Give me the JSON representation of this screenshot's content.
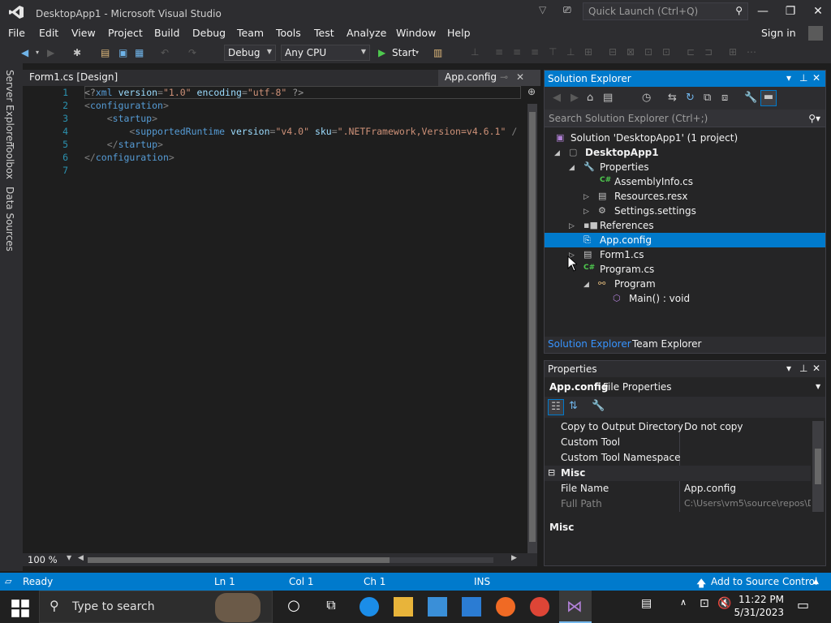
{
  "window": {
    "title": "DesktopApp1 - Microsoft Visual Studio",
    "quick_launch_placeholder": "Quick Launch (Ctrl+Q)"
  },
  "menu": [
    "File",
    "Edit",
    "View",
    "Project",
    "Build",
    "Debug",
    "Team",
    "Tools",
    "Test",
    "Analyze",
    "Window",
    "Help"
  ],
  "signin": "Sign in",
  "toolbar": {
    "config": "Debug",
    "platform": "Any CPU",
    "start": "Start"
  },
  "side_tabs": [
    "Server Explorer",
    "Toolbox",
    "Data Sources"
  ],
  "doc_tabs": {
    "inactive": "Form1.cs [Design]",
    "active": "App.config"
  },
  "editor": {
    "line_numbers": [
      "1",
      "2",
      "3",
      "4",
      "5",
      "6",
      "7"
    ],
    "zoom": "100 %"
  },
  "solution_explorer": {
    "title": "Solution Explorer",
    "search_placeholder": "Search Solution Explorer (Ctrl+;)",
    "items": [
      {
        "label": "Solution 'DesktopApp1' (1 project)"
      },
      {
        "label": "DesktopApp1"
      },
      {
        "label": "Properties"
      },
      {
        "label": "AssemblyInfo.cs"
      },
      {
        "label": "Resources.resx"
      },
      {
        "label": "Settings.settings"
      },
      {
        "label": "References"
      },
      {
        "label": "App.config"
      },
      {
        "label": "Form1.cs"
      },
      {
        "label": "Program.cs"
      },
      {
        "label": "Program"
      },
      {
        "label": "Main() : void"
      }
    ],
    "bottom_tabs": [
      "Solution Explorer",
      "Team Explorer"
    ]
  },
  "properties": {
    "title": "Properties",
    "object_name": "App.config",
    "object_type": "File Properties",
    "rows": [
      {
        "key": "Copy to Output Directory",
        "value": "Do not copy"
      },
      {
        "key": "Custom Tool",
        "value": ""
      },
      {
        "key": "Custom Tool Namespace",
        "value": ""
      },
      {
        "key": "File Name",
        "value": "App.config"
      },
      {
        "key": "Full Path",
        "value": "C:\\Users\\vm5\\source\\repos\\D"
      }
    ],
    "category": "Misc",
    "description_title": "Misc"
  },
  "status": {
    "state": "Ready",
    "ln": "Ln 1",
    "col": "Col 1",
    "ch": "Ch 1",
    "mode": "INS",
    "source_control": "Add to Source Control"
  },
  "taskbar": {
    "search_placeholder": "Type to search",
    "time": "11:22 PM",
    "date": "5/31/2023"
  },
  "colors": {
    "accent": "#007acc",
    "titlebar": "#2d2d30",
    "editor_bg": "#1e1e1e",
    "taskbar": "#202020"
  }
}
